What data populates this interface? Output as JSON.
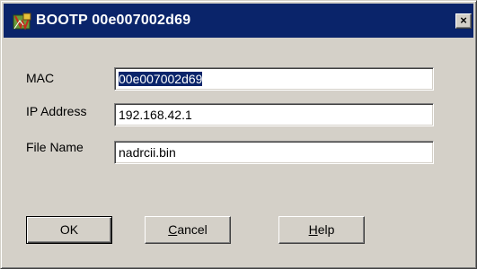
{
  "window": {
    "title": "BOOTP 00e007002d69",
    "close_glyph": "×",
    "icon": "bootp-app-icon"
  },
  "fields": {
    "mac": {
      "label": "MAC",
      "value": "00e007002d69"
    },
    "ip": {
      "label": "IP Address",
      "value": "192.168.42.1"
    },
    "file": {
      "label": "File Name",
      "value": "nadrcii.bin"
    }
  },
  "buttons": {
    "ok": {
      "label": "OK"
    },
    "cancel": {
      "first": "C",
      "rest": "ancel"
    },
    "help": {
      "first": "H",
      "rest": "elp"
    }
  },
  "colors": {
    "titlebar": "#0a246a",
    "face": "#d4d0c8",
    "selection": "#0a246a"
  }
}
